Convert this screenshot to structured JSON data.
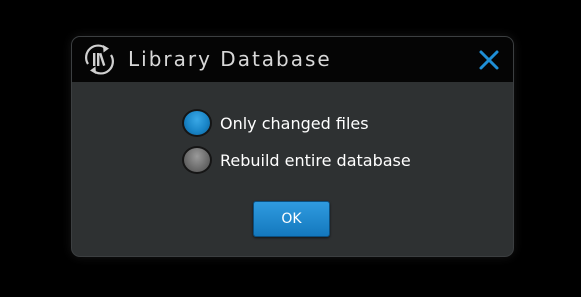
{
  "dialog": {
    "title": "Library Database",
    "app_icon": "library-sync-icon",
    "close_icon": "close-icon",
    "options": [
      {
        "label": "Only changed files",
        "selected": true
      },
      {
        "label": "Rebuild entire database",
        "selected": false
      }
    ],
    "ok_label": "OK"
  },
  "colors": {
    "accent": "#1a86c8",
    "titlebar": "#050505",
    "dialog_body": "#2e3132",
    "text": "#ffffff"
  }
}
